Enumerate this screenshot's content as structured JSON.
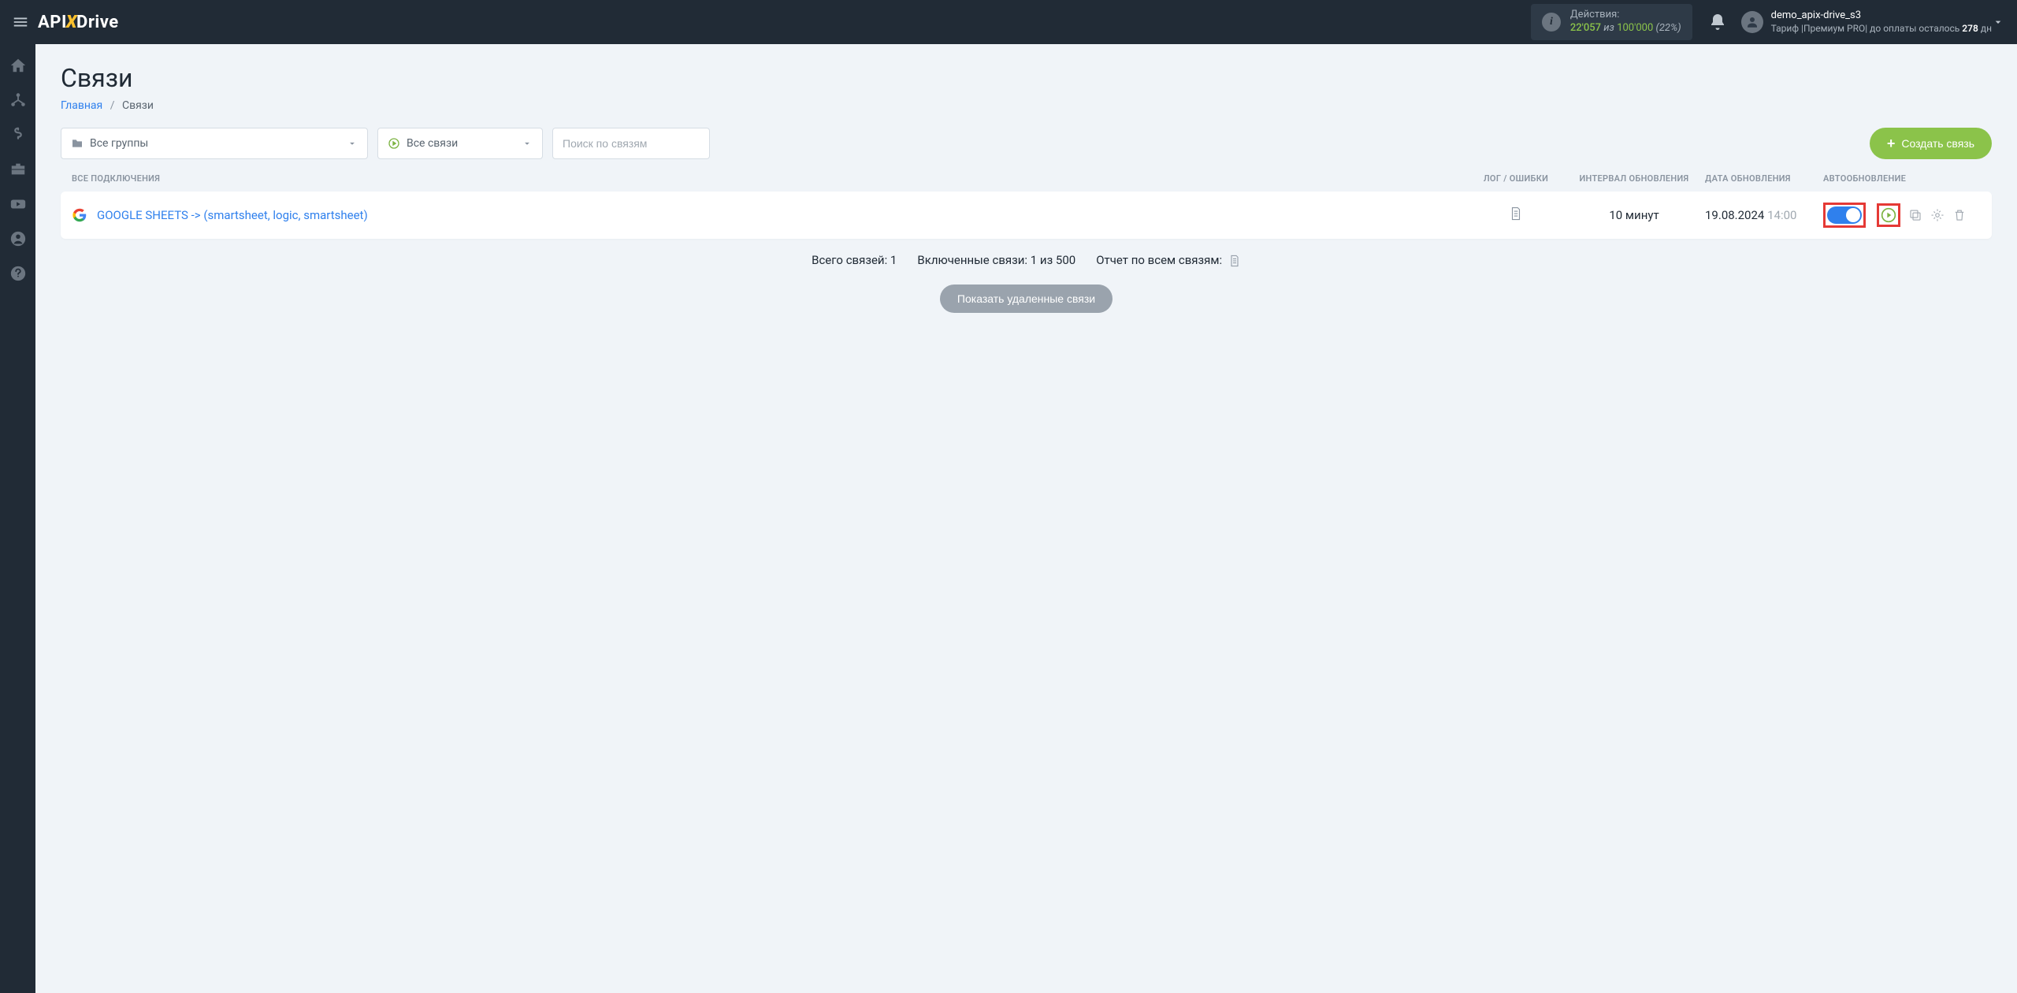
{
  "topbar": {
    "logo": {
      "part1": "API",
      "part2": "X",
      "part3": "Drive"
    },
    "actions": {
      "label": "Действия:",
      "used": "22'057",
      "of_word": "из",
      "total": "100'000",
      "percent": "(22%)"
    },
    "user": {
      "name": "demo_apix-drive_s3",
      "tariff_prefix": "Тариф |Премиум PRO| до оплаты осталось ",
      "days": "278",
      "days_suffix": " дн"
    }
  },
  "page": {
    "title": "Связи",
    "breadcrumb_home": "Главная",
    "breadcrumb_sep": "/",
    "breadcrumb_current": "Связи"
  },
  "filters": {
    "groups_label": "Все группы",
    "status_label": "Все связи",
    "search_placeholder": "Поиск по связям",
    "create_label": "Создать связь"
  },
  "table": {
    "headers": {
      "name": "ВСЕ ПОДКЛЮЧЕНИЯ",
      "log": "ЛОГ / ОШИБКИ",
      "interval": "ИНТЕРВАЛ ОБНОВЛЕНИЯ",
      "date": "ДАТА ОБНОВЛЕНИЯ",
      "auto": "АВТООБНОВЛЕНИЕ"
    },
    "rows": [
      {
        "name": "GOOGLE SHEETS -> (smartsheet, logic, smartsheet)",
        "interval": "10 минут",
        "date": "19.08.2024",
        "time": "14:00",
        "auto_enabled": true
      }
    ]
  },
  "summary": {
    "total": "Всего связей: 1",
    "enabled": "Включенные связи: 1 из 500",
    "report": "Отчет по всем связям:"
  },
  "deleted_button": "Показать удаленные связи"
}
